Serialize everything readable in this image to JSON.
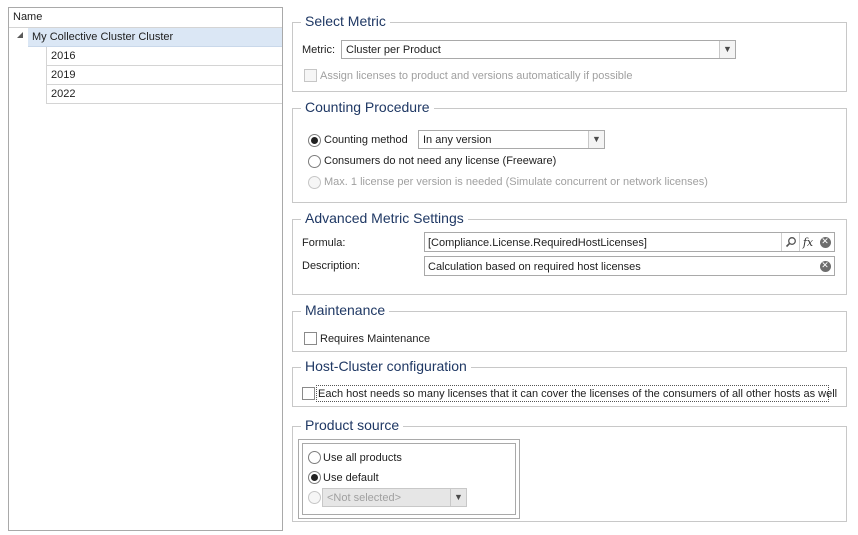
{
  "tree": {
    "header": "Name",
    "root": {
      "label": "My Collective Cluster Cluster",
      "expanded": true
    },
    "children": [
      {
        "label": "2016"
      },
      {
        "label": "2019"
      },
      {
        "label": "2022"
      }
    ]
  },
  "select_metric": {
    "title": "Select Metric",
    "metric_label": "Metric:",
    "metric_value": "Cluster per Product",
    "assign_label": "Assign licenses to product and versions automatically if possible",
    "assign_checked": false
  },
  "counting_procedure": {
    "title": "Counting Procedure",
    "counting_method_label": "Counting method",
    "counting_method_value": "In any version",
    "freeware_label": "Consumers do not need any license (Freeware)",
    "max_label": "Max.  1 license per version is needed (Simulate concurrent or network licenses)",
    "selected": "counting_method"
  },
  "advanced_metric": {
    "title": "Advanced Metric Settings",
    "formula_label": "Formula:",
    "formula_value": "[Compliance.License.RequiredHostLicenses]",
    "formula_fx": "fx",
    "description_label": "Description:",
    "description_value": "Calculation based on required host licenses",
    "clear_glyph": "✕"
  },
  "maintenance": {
    "title": "Maintenance",
    "requires_label": "Requires Maintenance",
    "requires_checked": false
  },
  "host_cluster": {
    "title": "Host-Cluster configuration",
    "each_host_label": "Each host needs so many licenses that it can cover the licenses of the consumers of all other hosts as well",
    "each_host_checked": false
  },
  "product_source": {
    "title": "Product source",
    "use_all_label": "Use all products",
    "use_default_label": "Use default",
    "not_selected_value": "<Not selected>",
    "selected": "use_default"
  },
  "icons": {
    "search": "search-icon",
    "fx": "fx-icon",
    "clear": "clear-icon",
    "dropdown": "chevron-down-icon",
    "expander": "tree-expander-icon"
  },
  "colors": {
    "group_title": "#1f3864",
    "tree_selection": "#dbe7f5",
    "border": "#c8c8c8"
  }
}
